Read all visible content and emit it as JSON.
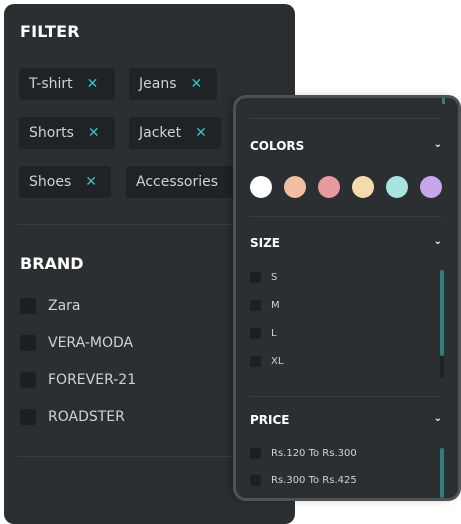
{
  "filter": {
    "title": "FILTER",
    "chips": [
      {
        "label": "T-shirt",
        "remove": "✕"
      },
      {
        "label": "Jeans",
        "remove": "✕"
      },
      {
        "label": "Shorts",
        "remove": "✕"
      },
      {
        "label": "Jacket",
        "remove": "✕"
      },
      {
        "label": "Shoes",
        "remove": "✕"
      },
      {
        "label": "Accessories",
        "remove": "✕"
      }
    ]
  },
  "brand": {
    "title": "BRAND",
    "items": [
      "Zara",
      "VERA-MODA",
      "FOREVER-21",
      "ROADSTER"
    ]
  },
  "colors": {
    "title": "COLORS",
    "chevron": "⌄",
    "swatches": [
      "#ffffff",
      "#f0bfa1",
      "#e79a9d",
      "#f3dcaa",
      "#a8e3de",
      "#c9a6ea"
    ]
  },
  "size": {
    "title": "SIZE",
    "chevron": "⌄",
    "items": [
      "S",
      "M",
      "L",
      "XL"
    ]
  },
  "price": {
    "title": "PRICE",
    "chevron": "⌄",
    "items": [
      "Rs.120 To Rs.300",
      "Rs.300 To Rs.425"
    ]
  }
}
